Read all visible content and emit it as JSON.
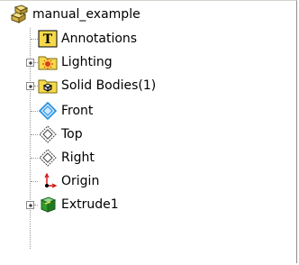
{
  "feature_tree": {
    "root": {
      "label": "manual_example",
      "icon": "part-icon"
    },
    "items": [
      {
        "label": "Annotations",
        "icon": "annotations-icon",
        "expandable": false
      },
      {
        "label": "Lighting",
        "icon": "lighting-folder-icon",
        "expandable": true
      },
      {
        "label": "Solid Bodies(1)",
        "icon": "solid-bodies-folder-icon",
        "expandable": true
      },
      {
        "label": "Front",
        "icon": "plane-icon",
        "expandable": false,
        "selected_style": true
      },
      {
        "label": "Top",
        "icon": "plane-icon",
        "expandable": false
      },
      {
        "label": "Right",
        "icon": "plane-icon",
        "expandable": false
      },
      {
        "label": "Origin",
        "icon": "origin-icon",
        "expandable": false
      },
      {
        "label": "Extrude1",
        "icon": "extrude-icon",
        "expandable": true
      }
    ]
  },
  "colors": {
    "folder_yellow": "#f5d94a",
    "plane_selected": "#1f8fe0",
    "origin_red": "#d01010",
    "extrude_green": "#2f9c2f"
  }
}
